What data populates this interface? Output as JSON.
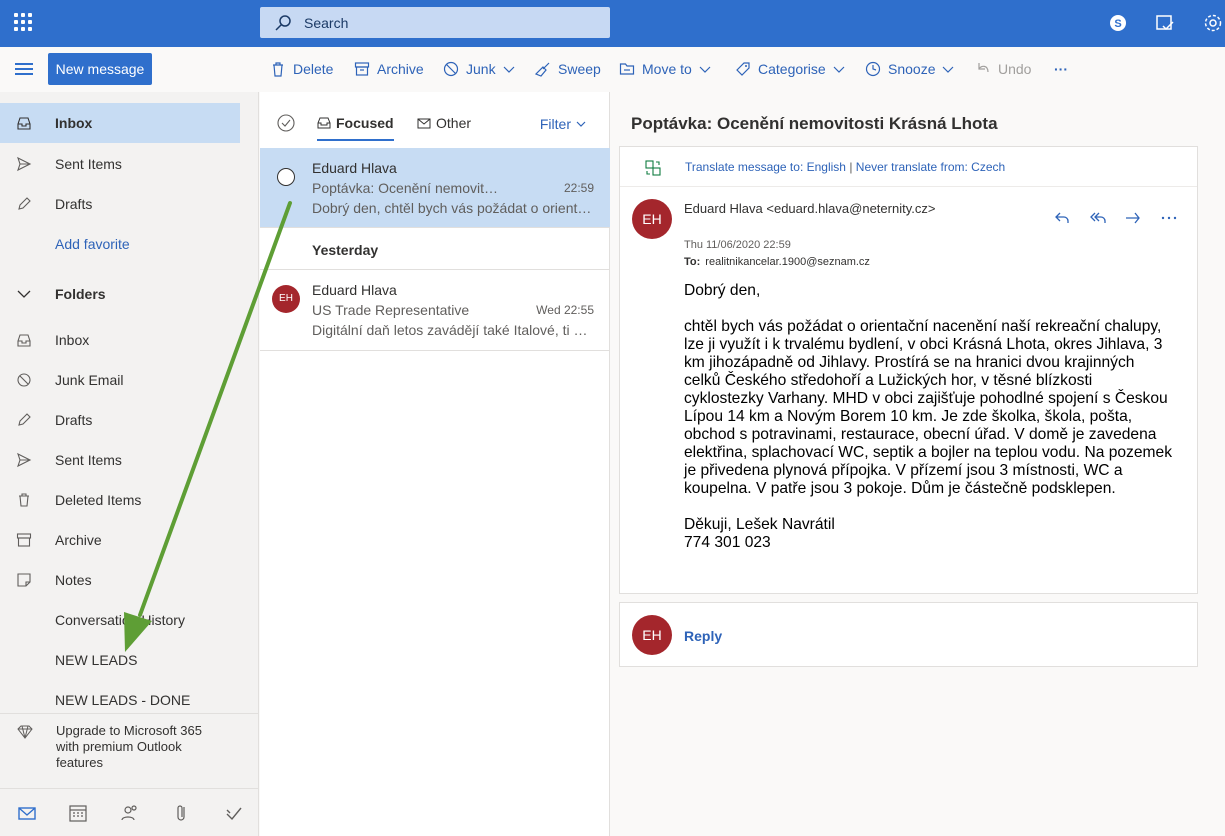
{
  "topbar": {
    "search_placeholder": "Search"
  },
  "toolbar": {
    "new_message": "New message",
    "delete": "Delete",
    "archive": "Archive",
    "junk": "Junk",
    "sweep": "Sweep",
    "move_to": "Move to",
    "categorise": "Categorise",
    "snooze": "Snooze",
    "undo": "Undo",
    "more": "···"
  },
  "sidebar": {
    "favorites": [
      {
        "label": "Inbox",
        "icon": "inbox-icon"
      },
      {
        "label": "Sent Items",
        "icon": "send-icon"
      },
      {
        "label": "Drafts",
        "icon": "pencil-icon"
      }
    ],
    "add_favorite": "Add favorite",
    "folders_header": "Folders",
    "folders": [
      {
        "label": "Inbox",
        "icon": "inbox-icon"
      },
      {
        "label": "Junk Email",
        "icon": "junk-icon"
      },
      {
        "label": "Drafts",
        "icon": "pencil-icon"
      },
      {
        "label": "Sent Items",
        "icon": "send-icon"
      },
      {
        "label": "Deleted Items",
        "icon": "trash-icon"
      },
      {
        "label": "Archive",
        "icon": "archive-icon"
      },
      {
        "label": "Notes",
        "icon": "notes-icon"
      },
      {
        "label": "Conversation History",
        "icon": ""
      },
      {
        "label": "NEW LEADS",
        "icon": ""
      },
      {
        "label": "NEW LEADS - DONE",
        "icon": ""
      }
    ],
    "upgrade": "Upgrade to Microsoft 365 with premium Outlook features"
  },
  "list": {
    "tab_focused": "Focused",
    "tab_other": "Other",
    "filter": "Filter",
    "group_yesterday": "Yesterday",
    "messages": [
      {
        "from": "Eduard Hlava",
        "subject": "Poptávka: Ocenění nemovitosti Krásná Lhota",
        "time": "22:59",
        "preview": "Dobrý den, chtěl bych vás požádat o orientační nacenění naší rekreační chalupy"
      },
      {
        "from": "Eduard Hlava",
        "initials": "EH",
        "subject": "US Trade Representative",
        "time": "Wed 22:55",
        "preview": "Digitální daň letos zavádějí také Italové, ti dokonce"
      }
    ]
  },
  "reading": {
    "subject": "Poptávka: Ocenění nemovitosti Krásná Lhota",
    "translate_link": "Translate message to: English",
    "translate_sep": "|",
    "never_translate": "Never translate from: Czech",
    "initials": "EH",
    "sender": "Eduard Hlava <eduard.hlava@neternity.cz>",
    "date": "Thu 11/06/2020 22:59",
    "to_label": "To:",
    "to_value": "realitnikancelar.1900@seznam.cz",
    "greeting": "Dobrý den,",
    "paragraph": "chtěl bych vás požádat o orientační nacenění naší rekreační chalupy, lze ji využít i k trvalému bydlení, v obci Krásná Lhota, okres Jihlava, 3 km jihozápadně od Jihlavy. Prostírá se na hranici dvou krajinných celků Českého středohoří a Lužických hor, v těsné blízkosti cyklostezky Varhany. MHD v obci zajišťuje pohodlné spojení s Českou Lípou 14 km a Novým Borem 10 km. Je zde školka, škola, pošta, obchod s potravinami, restaurace, obecní úřad. V domě je zavedena elektřina, splachovací WC, septik a bojler na teplou vodu. Na pozemek je přivedena plynová přípojka. V přízemí jsou 3 místnosti, WC a koupelna. V patře jsou 3 pokoje. Dům je částečně podsklepen.",
    "signoff": "Děkuji, Lešek Navrátil",
    "phone": "774 301 023",
    "reply": "Reply"
  },
  "colors": {
    "accent": "#2f6fcc",
    "avatar": "#a4262c",
    "annotation_arrow": "#5e9e35"
  }
}
